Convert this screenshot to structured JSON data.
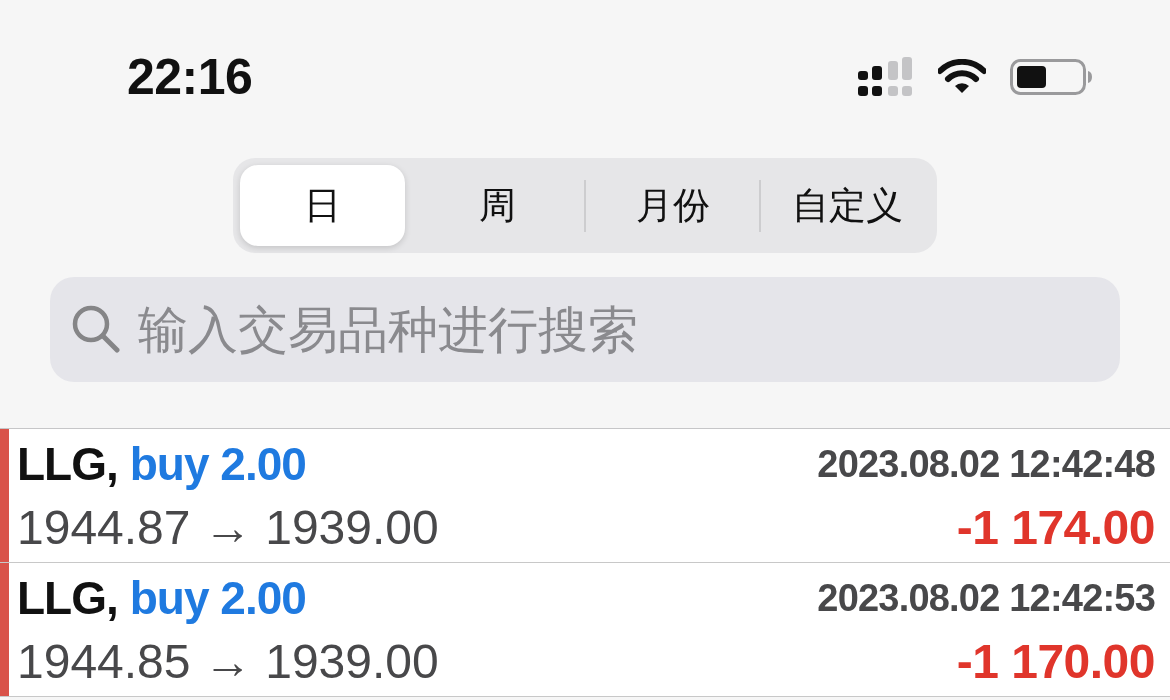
{
  "status_bar": {
    "time": "22:16"
  },
  "period_tabs": [
    {
      "label": "日",
      "selected": true
    },
    {
      "label": "周",
      "selected": false
    },
    {
      "label": "月份",
      "selected": false
    },
    {
      "label": "自定义",
      "selected": false
    }
  ],
  "search": {
    "placeholder": "输入交易品种进行搜索"
  },
  "trades": [
    {
      "symbol": "LLG,",
      "order": "buy 2.00",
      "time": "2023.08.02 12:42:48",
      "prices": "1944.87 → 1939.00",
      "profit": "-1 174.00",
      "color": "#d9534a"
    },
    {
      "symbol": "LLG,",
      "order": "buy 2.00",
      "time": "2023.08.02 12:42:53",
      "prices": "1944.85 → 1939.00",
      "profit": "-1 170.00",
      "color": "#d9534a"
    }
  ]
}
